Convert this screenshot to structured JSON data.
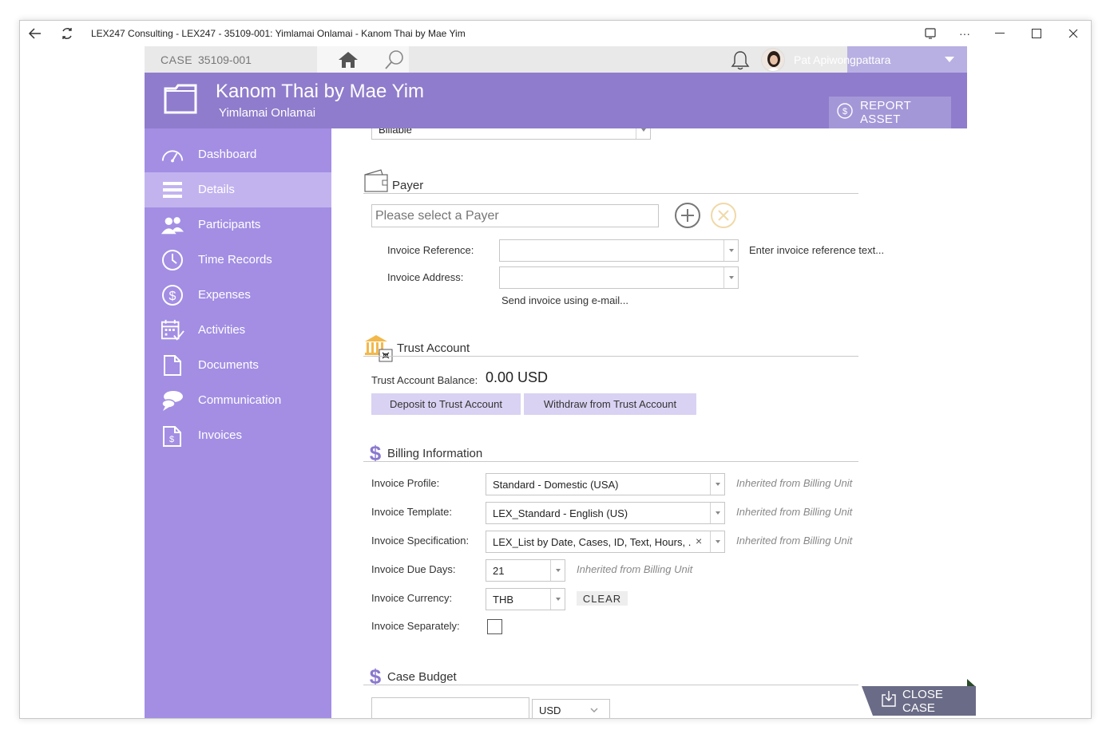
{
  "window": {
    "title": "LEX247 Consulting - LEX247 - 35109-001: Yimlamai Onlamai - Kanom Thai by Mae Yim"
  },
  "topbar": {
    "case_label": "CASE",
    "case_number": "35109-001",
    "user_name": "Pat Apiwongpattara"
  },
  "header": {
    "title": "Kanom Thai by Mae Yim",
    "subtitle": "Yimlamai Onlamai",
    "report_button": "REPORT ASSET"
  },
  "sidebar": {
    "items": [
      {
        "label": "Dashboard",
        "icon": "gauge-icon"
      },
      {
        "label": "Details",
        "icon": "list-icon"
      },
      {
        "label": "Participants",
        "icon": "people-icon"
      },
      {
        "label": "Time Records",
        "icon": "clock-icon"
      },
      {
        "label": "Expenses",
        "icon": "dollar-circle-icon"
      },
      {
        "label": "Activities",
        "icon": "calendar-check-icon"
      },
      {
        "label": "Documents",
        "icon": "document-icon"
      },
      {
        "label": "Communication",
        "icon": "chat-bubbles-icon"
      },
      {
        "label": "Invoices",
        "icon": "invoice-icon"
      }
    ],
    "active": "Details"
  },
  "content": {
    "top_combo_value": "Billable",
    "payer": {
      "title": "Payer",
      "placeholder": "Please select a Payer",
      "invoice_reference_label": "Invoice Reference:",
      "invoice_reference_hint": "Enter invoice reference text...",
      "invoice_address_label": "Invoice Address:",
      "send_email_link": "Send invoice using e-mail..."
    },
    "trust": {
      "title": "Trust Account",
      "balance_label": "Trust Account Balance:",
      "balance_value": "0.00 USD",
      "deposit_button": "Deposit to Trust Account",
      "withdraw_button": "Withdraw from Trust Account"
    },
    "billing": {
      "title": "Billing Information",
      "profile_label": "Invoice Profile:",
      "profile_value": "Standard - Domestic (USA)",
      "profile_hint": "Inherited from Billing Unit",
      "template_label": "Invoice Template:",
      "template_value": "LEX_Standard - English (US)",
      "template_hint": "Inherited from Billing Unit",
      "spec_label": "Invoice Specification:",
      "spec_value": "LEX_List by Date, Cases, ID, Text, Hours, ...",
      "spec_hint": "Inherited from Billing Unit",
      "due_days_label": "Invoice Due Days:",
      "due_days_value": "21",
      "due_days_hint": "Inherited from Billing Unit",
      "currency_label": "Invoice Currency:",
      "currency_value": "THB",
      "clear_button": "CLEAR",
      "separately_label": "Invoice Separately:",
      "separately_checked": false
    },
    "budget": {
      "title": "Case Budget",
      "currency_value": "USD"
    }
  },
  "close_case_button": "CLOSE CASE",
  "colors": {
    "header": "#8f7ccc",
    "sidebar": "#a38ee4",
    "sidebar_active": "#c2b3ef",
    "accent_light": "#dad2f3"
  }
}
